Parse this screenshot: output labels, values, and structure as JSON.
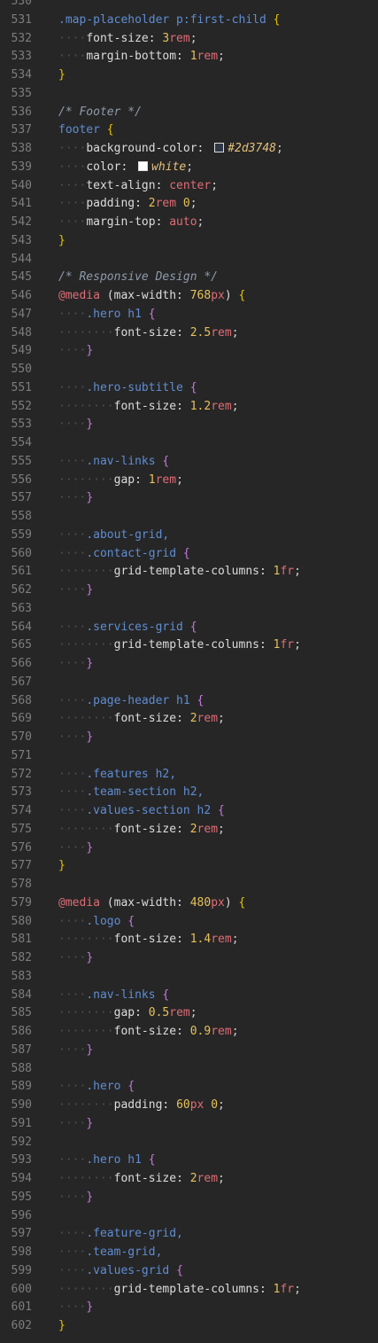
{
  "editor": {
    "colors": {
      "background": "#262626",
      "selector": "#5f8dd3",
      "brace": "#e5c100",
      "nested_brace": "#c678dd",
      "number": "#e6c15a",
      "keyword": "#e06c75",
      "comment": "#8e9bab"
    },
    "lines": [
      {
        "n": "530",
        "t": []
      },
      {
        "n": "531",
        "t": [
          [
            "sel",
            ".map-placeholder p:first-child "
          ],
          [
            "brace",
            "{"
          ]
        ]
      },
      {
        "n": "532",
        "t": [
          [
            "ws",
            "····"
          ],
          [
            "prop",
            "font-size: "
          ],
          [
            "num",
            "3"
          ],
          [
            "unit",
            "rem"
          ],
          [
            "punc",
            ";"
          ]
        ]
      },
      {
        "n": "533",
        "t": [
          [
            "ws",
            "····"
          ],
          [
            "prop",
            "margin-bottom: "
          ],
          [
            "num",
            "1"
          ],
          [
            "unit",
            "rem"
          ],
          [
            "punc",
            ";"
          ]
        ]
      },
      {
        "n": "534",
        "t": [
          [
            "brace",
            "}"
          ]
        ]
      },
      {
        "n": "535",
        "t": []
      },
      {
        "n": "536",
        "t": [
          [
            "comment",
            "/* Footer */"
          ]
        ]
      },
      {
        "n": "537",
        "t": [
          [
            "sel",
            "footer "
          ],
          [
            "brace",
            "{"
          ]
        ]
      },
      {
        "n": "538",
        "t": [
          [
            "ws",
            "····"
          ],
          [
            "prop",
            "background-color: "
          ],
          [
            "swatch",
            "#2d3748"
          ],
          [
            "str",
            "#2d3748"
          ],
          [
            "punc",
            ";"
          ]
        ]
      },
      {
        "n": "539",
        "t": [
          [
            "ws",
            "····"
          ],
          [
            "prop",
            "color: "
          ],
          [
            "swatch",
            "#ffffff"
          ],
          [
            "str",
            "white"
          ],
          [
            "punc",
            ";"
          ]
        ]
      },
      {
        "n": "540",
        "t": [
          [
            "ws",
            "····"
          ],
          [
            "prop",
            "text-align: "
          ],
          [
            "kw",
            "center"
          ],
          [
            "punc",
            ";"
          ]
        ]
      },
      {
        "n": "541",
        "t": [
          [
            "ws",
            "····"
          ],
          [
            "prop",
            "padding: "
          ],
          [
            "num",
            "2"
          ],
          [
            "unit",
            "rem"
          ],
          [
            "prop",
            " "
          ],
          [
            "num",
            "0"
          ],
          [
            "punc",
            ";"
          ]
        ]
      },
      {
        "n": "542",
        "t": [
          [
            "ws",
            "····"
          ],
          [
            "prop",
            "margin-top: "
          ],
          [
            "kw",
            "auto"
          ],
          [
            "punc",
            ";"
          ]
        ]
      },
      {
        "n": "543",
        "t": [
          [
            "brace",
            "}"
          ]
        ]
      },
      {
        "n": "544",
        "t": []
      },
      {
        "n": "545",
        "t": [
          [
            "comment",
            "/* Responsive Design */"
          ]
        ]
      },
      {
        "n": "546",
        "t": [
          [
            "at",
            "@media"
          ],
          [
            "prop",
            " (max-width: "
          ],
          [
            "num",
            "768"
          ],
          [
            "unit",
            "px"
          ],
          [
            "prop",
            ") "
          ],
          [
            "brace",
            "{"
          ]
        ]
      },
      {
        "n": "547",
        "t": [
          [
            "ws",
            "····"
          ],
          [
            "sel",
            ".hero h1 "
          ],
          [
            "brace2",
            "{"
          ]
        ]
      },
      {
        "n": "548",
        "t": [
          [
            "ws",
            "········"
          ],
          [
            "prop",
            "font-size: "
          ],
          [
            "num",
            "2.5"
          ],
          [
            "unit",
            "rem"
          ],
          [
            "punc",
            ";"
          ]
        ]
      },
      {
        "n": "549",
        "t": [
          [
            "ws",
            "····"
          ],
          [
            "brace2",
            "}"
          ]
        ]
      },
      {
        "n": "550",
        "t": []
      },
      {
        "n": "551",
        "t": [
          [
            "ws",
            "····"
          ],
          [
            "sel",
            ".hero-subtitle "
          ],
          [
            "brace2",
            "{"
          ]
        ]
      },
      {
        "n": "552",
        "t": [
          [
            "ws",
            "········"
          ],
          [
            "prop",
            "font-size: "
          ],
          [
            "num",
            "1.2"
          ],
          [
            "unit",
            "rem"
          ],
          [
            "punc",
            ";"
          ]
        ]
      },
      {
        "n": "553",
        "t": [
          [
            "ws",
            "····"
          ],
          [
            "brace2",
            "}"
          ]
        ]
      },
      {
        "n": "554",
        "t": []
      },
      {
        "n": "555",
        "t": [
          [
            "ws",
            "····"
          ],
          [
            "sel",
            ".nav-links "
          ],
          [
            "brace2",
            "{"
          ]
        ]
      },
      {
        "n": "556",
        "t": [
          [
            "ws",
            "········"
          ],
          [
            "prop",
            "gap: "
          ],
          [
            "num",
            "1"
          ],
          [
            "unit",
            "rem"
          ],
          [
            "punc",
            ";"
          ]
        ]
      },
      {
        "n": "557",
        "t": [
          [
            "ws",
            "····"
          ],
          [
            "brace2",
            "}"
          ]
        ]
      },
      {
        "n": "558",
        "t": []
      },
      {
        "n": "559",
        "t": [
          [
            "ws",
            "····"
          ],
          [
            "sel",
            ".about-grid,"
          ]
        ]
      },
      {
        "n": "560",
        "t": [
          [
            "ws",
            "····"
          ],
          [
            "sel",
            ".contact-grid "
          ],
          [
            "brace2",
            "{"
          ]
        ]
      },
      {
        "n": "561",
        "t": [
          [
            "ws",
            "········"
          ],
          [
            "prop",
            "grid-template-columns: "
          ],
          [
            "num",
            "1"
          ],
          [
            "unit",
            "fr"
          ],
          [
            "punc",
            ";"
          ]
        ]
      },
      {
        "n": "562",
        "t": [
          [
            "ws",
            "····"
          ],
          [
            "brace2",
            "}"
          ]
        ]
      },
      {
        "n": "563",
        "t": []
      },
      {
        "n": "564",
        "t": [
          [
            "ws",
            "····"
          ],
          [
            "sel",
            ".services-grid "
          ],
          [
            "brace2",
            "{"
          ]
        ]
      },
      {
        "n": "565",
        "t": [
          [
            "ws",
            "········"
          ],
          [
            "prop",
            "grid-template-columns: "
          ],
          [
            "num",
            "1"
          ],
          [
            "unit",
            "fr"
          ],
          [
            "punc",
            ";"
          ]
        ]
      },
      {
        "n": "566",
        "t": [
          [
            "ws",
            "····"
          ],
          [
            "brace2",
            "}"
          ]
        ]
      },
      {
        "n": "567",
        "t": []
      },
      {
        "n": "568",
        "t": [
          [
            "ws",
            "····"
          ],
          [
            "sel",
            ".page-header h1 "
          ],
          [
            "brace2",
            "{"
          ]
        ]
      },
      {
        "n": "569",
        "t": [
          [
            "ws",
            "········"
          ],
          [
            "prop",
            "font-size: "
          ],
          [
            "num",
            "2"
          ],
          [
            "unit",
            "rem"
          ],
          [
            "punc",
            ";"
          ]
        ]
      },
      {
        "n": "570",
        "t": [
          [
            "ws",
            "····"
          ],
          [
            "brace2",
            "}"
          ]
        ]
      },
      {
        "n": "571",
        "t": []
      },
      {
        "n": "572",
        "t": [
          [
            "ws",
            "····"
          ],
          [
            "sel",
            ".features h2,"
          ]
        ]
      },
      {
        "n": "573",
        "t": [
          [
            "ws",
            "····"
          ],
          [
            "sel",
            ".team-section h2,"
          ]
        ]
      },
      {
        "n": "574",
        "t": [
          [
            "ws",
            "····"
          ],
          [
            "sel",
            ".values-section h2 "
          ],
          [
            "brace2",
            "{"
          ]
        ]
      },
      {
        "n": "575",
        "t": [
          [
            "ws",
            "········"
          ],
          [
            "prop",
            "font-size: "
          ],
          [
            "num",
            "2"
          ],
          [
            "unit",
            "rem"
          ],
          [
            "punc",
            ";"
          ]
        ]
      },
      {
        "n": "576",
        "t": [
          [
            "ws",
            "····"
          ],
          [
            "brace2",
            "}"
          ]
        ]
      },
      {
        "n": "577",
        "t": [
          [
            "brace",
            "}"
          ]
        ]
      },
      {
        "n": "578",
        "t": []
      },
      {
        "n": "579",
        "t": [
          [
            "at",
            "@media"
          ],
          [
            "prop",
            " (max-width: "
          ],
          [
            "num",
            "480"
          ],
          [
            "unit",
            "px"
          ],
          [
            "prop",
            ") "
          ],
          [
            "brace",
            "{"
          ]
        ]
      },
      {
        "n": "580",
        "t": [
          [
            "ws",
            "····"
          ],
          [
            "sel",
            ".logo "
          ],
          [
            "brace2",
            "{"
          ]
        ]
      },
      {
        "n": "581",
        "t": [
          [
            "ws",
            "········"
          ],
          [
            "prop",
            "font-size: "
          ],
          [
            "num",
            "1.4"
          ],
          [
            "unit",
            "rem"
          ],
          [
            "punc",
            ";"
          ]
        ]
      },
      {
        "n": "582",
        "t": [
          [
            "ws",
            "····"
          ],
          [
            "brace2",
            "}"
          ]
        ]
      },
      {
        "n": "583",
        "t": []
      },
      {
        "n": "584",
        "t": [
          [
            "ws",
            "····"
          ],
          [
            "sel",
            ".nav-links "
          ],
          [
            "brace2",
            "{"
          ]
        ]
      },
      {
        "n": "585",
        "t": [
          [
            "ws",
            "········"
          ],
          [
            "prop",
            "gap: "
          ],
          [
            "num",
            "0.5"
          ],
          [
            "unit",
            "rem"
          ],
          [
            "punc",
            ";"
          ]
        ]
      },
      {
        "n": "586",
        "t": [
          [
            "ws",
            "········"
          ],
          [
            "prop",
            "font-size: "
          ],
          [
            "num",
            "0.9"
          ],
          [
            "unit",
            "rem"
          ],
          [
            "punc",
            ";"
          ]
        ]
      },
      {
        "n": "587",
        "t": [
          [
            "ws",
            "····"
          ],
          [
            "brace2",
            "}"
          ]
        ]
      },
      {
        "n": "588",
        "t": []
      },
      {
        "n": "589",
        "t": [
          [
            "ws",
            "····"
          ],
          [
            "sel",
            ".hero "
          ],
          [
            "brace2",
            "{"
          ]
        ]
      },
      {
        "n": "590",
        "t": [
          [
            "ws",
            "········"
          ],
          [
            "prop",
            "padding: "
          ],
          [
            "num",
            "60"
          ],
          [
            "unit",
            "px"
          ],
          [
            "prop",
            " "
          ],
          [
            "num",
            "0"
          ],
          [
            "punc",
            ";"
          ]
        ]
      },
      {
        "n": "591",
        "t": [
          [
            "ws",
            "····"
          ],
          [
            "brace2",
            "}"
          ]
        ]
      },
      {
        "n": "592",
        "t": []
      },
      {
        "n": "593",
        "t": [
          [
            "ws",
            "····"
          ],
          [
            "sel",
            ".hero h1 "
          ],
          [
            "brace2",
            "{"
          ]
        ]
      },
      {
        "n": "594",
        "t": [
          [
            "ws",
            "········"
          ],
          [
            "prop",
            "font-size: "
          ],
          [
            "num",
            "2"
          ],
          [
            "unit",
            "rem"
          ],
          [
            "punc",
            ";"
          ]
        ]
      },
      {
        "n": "595",
        "t": [
          [
            "ws",
            "····"
          ],
          [
            "brace2",
            "}"
          ]
        ]
      },
      {
        "n": "596",
        "t": []
      },
      {
        "n": "597",
        "t": [
          [
            "ws",
            "····"
          ],
          [
            "sel",
            ".feature-grid,"
          ]
        ]
      },
      {
        "n": "598",
        "t": [
          [
            "ws",
            "····"
          ],
          [
            "sel",
            ".team-grid,"
          ]
        ]
      },
      {
        "n": "599",
        "t": [
          [
            "ws",
            "····"
          ],
          [
            "sel",
            ".values-grid "
          ],
          [
            "brace2",
            "{"
          ]
        ]
      },
      {
        "n": "600",
        "t": [
          [
            "ws",
            "········"
          ],
          [
            "prop",
            "grid-template-columns: "
          ],
          [
            "num",
            "1"
          ],
          [
            "unit",
            "fr"
          ],
          [
            "punc",
            ";"
          ]
        ]
      },
      {
        "n": "601",
        "t": [
          [
            "ws",
            "····"
          ],
          [
            "brace2",
            "}"
          ]
        ]
      },
      {
        "n": "602",
        "t": [
          [
            "brace",
            "}"
          ]
        ]
      }
    ]
  }
}
